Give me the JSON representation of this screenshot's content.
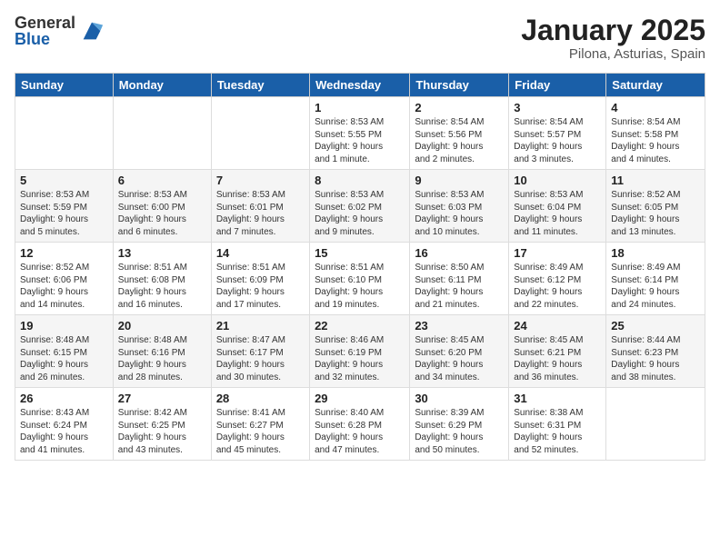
{
  "logo": {
    "general": "General",
    "blue": "Blue"
  },
  "title": "January 2025",
  "location": "Pilona, Asturias, Spain",
  "headers": [
    "Sunday",
    "Monday",
    "Tuesday",
    "Wednesday",
    "Thursday",
    "Friday",
    "Saturday"
  ],
  "weeks": [
    [
      {
        "day": "",
        "text": ""
      },
      {
        "day": "",
        "text": ""
      },
      {
        "day": "",
        "text": ""
      },
      {
        "day": "1",
        "text": "Sunrise: 8:53 AM\nSunset: 5:55 PM\nDaylight: 9 hours\nand 1 minute."
      },
      {
        "day": "2",
        "text": "Sunrise: 8:54 AM\nSunset: 5:56 PM\nDaylight: 9 hours\nand 2 minutes."
      },
      {
        "day": "3",
        "text": "Sunrise: 8:54 AM\nSunset: 5:57 PM\nDaylight: 9 hours\nand 3 minutes."
      },
      {
        "day": "4",
        "text": "Sunrise: 8:54 AM\nSunset: 5:58 PM\nDaylight: 9 hours\nand 4 minutes."
      }
    ],
    [
      {
        "day": "5",
        "text": "Sunrise: 8:53 AM\nSunset: 5:59 PM\nDaylight: 9 hours\nand 5 minutes."
      },
      {
        "day": "6",
        "text": "Sunrise: 8:53 AM\nSunset: 6:00 PM\nDaylight: 9 hours\nand 6 minutes."
      },
      {
        "day": "7",
        "text": "Sunrise: 8:53 AM\nSunset: 6:01 PM\nDaylight: 9 hours\nand 7 minutes."
      },
      {
        "day": "8",
        "text": "Sunrise: 8:53 AM\nSunset: 6:02 PM\nDaylight: 9 hours\nand 9 minutes."
      },
      {
        "day": "9",
        "text": "Sunrise: 8:53 AM\nSunset: 6:03 PM\nDaylight: 9 hours\nand 10 minutes."
      },
      {
        "day": "10",
        "text": "Sunrise: 8:53 AM\nSunset: 6:04 PM\nDaylight: 9 hours\nand 11 minutes."
      },
      {
        "day": "11",
        "text": "Sunrise: 8:52 AM\nSunset: 6:05 PM\nDaylight: 9 hours\nand 13 minutes."
      }
    ],
    [
      {
        "day": "12",
        "text": "Sunrise: 8:52 AM\nSunset: 6:06 PM\nDaylight: 9 hours\nand 14 minutes."
      },
      {
        "day": "13",
        "text": "Sunrise: 8:51 AM\nSunset: 6:08 PM\nDaylight: 9 hours\nand 16 minutes."
      },
      {
        "day": "14",
        "text": "Sunrise: 8:51 AM\nSunset: 6:09 PM\nDaylight: 9 hours\nand 17 minutes."
      },
      {
        "day": "15",
        "text": "Sunrise: 8:51 AM\nSunset: 6:10 PM\nDaylight: 9 hours\nand 19 minutes."
      },
      {
        "day": "16",
        "text": "Sunrise: 8:50 AM\nSunset: 6:11 PM\nDaylight: 9 hours\nand 21 minutes."
      },
      {
        "day": "17",
        "text": "Sunrise: 8:49 AM\nSunset: 6:12 PM\nDaylight: 9 hours\nand 22 minutes."
      },
      {
        "day": "18",
        "text": "Sunrise: 8:49 AM\nSunset: 6:14 PM\nDaylight: 9 hours\nand 24 minutes."
      }
    ],
    [
      {
        "day": "19",
        "text": "Sunrise: 8:48 AM\nSunset: 6:15 PM\nDaylight: 9 hours\nand 26 minutes."
      },
      {
        "day": "20",
        "text": "Sunrise: 8:48 AM\nSunset: 6:16 PM\nDaylight: 9 hours\nand 28 minutes."
      },
      {
        "day": "21",
        "text": "Sunrise: 8:47 AM\nSunset: 6:17 PM\nDaylight: 9 hours\nand 30 minutes."
      },
      {
        "day": "22",
        "text": "Sunrise: 8:46 AM\nSunset: 6:19 PM\nDaylight: 9 hours\nand 32 minutes."
      },
      {
        "day": "23",
        "text": "Sunrise: 8:45 AM\nSunset: 6:20 PM\nDaylight: 9 hours\nand 34 minutes."
      },
      {
        "day": "24",
        "text": "Sunrise: 8:45 AM\nSunset: 6:21 PM\nDaylight: 9 hours\nand 36 minutes."
      },
      {
        "day": "25",
        "text": "Sunrise: 8:44 AM\nSunset: 6:23 PM\nDaylight: 9 hours\nand 38 minutes."
      }
    ],
    [
      {
        "day": "26",
        "text": "Sunrise: 8:43 AM\nSunset: 6:24 PM\nDaylight: 9 hours\nand 41 minutes."
      },
      {
        "day": "27",
        "text": "Sunrise: 8:42 AM\nSunset: 6:25 PM\nDaylight: 9 hours\nand 43 minutes."
      },
      {
        "day": "28",
        "text": "Sunrise: 8:41 AM\nSunset: 6:27 PM\nDaylight: 9 hours\nand 45 minutes."
      },
      {
        "day": "29",
        "text": "Sunrise: 8:40 AM\nSunset: 6:28 PM\nDaylight: 9 hours\nand 47 minutes."
      },
      {
        "day": "30",
        "text": "Sunrise: 8:39 AM\nSunset: 6:29 PM\nDaylight: 9 hours\nand 50 minutes."
      },
      {
        "day": "31",
        "text": "Sunrise: 8:38 AM\nSunset: 6:31 PM\nDaylight: 9 hours\nand 52 minutes."
      },
      {
        "day": "",
        "text": ""
      }
    ]
  ]
}
